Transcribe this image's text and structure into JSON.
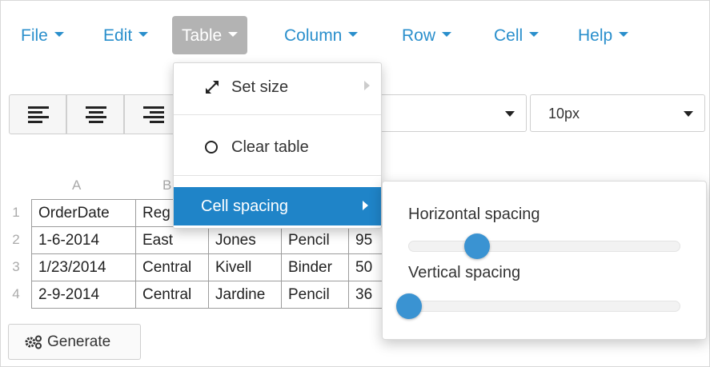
{
  "menubar": {
    "items": [
      {
        "label": "File",
        "active": false
      },
      {
        "label": "Edit",
        "active": false
      },
      {
        "label": "Table",
        "active": true
      },
      {
        "label": "Column",
        "active": false
      },
      {
        "label": "Row",
        "active": false
      },
      {
        "label": "Cell",
        "active": false
      },
      {
        "label": "Help",
        "active": false
      }
    ]
  },
  "toolbar": {
    "align_icons": [
      "align-left-icon",
      "align-center-icon",
      "align-right-icon"
    ],
    "font_select_value": "",
    "size_select_value": "10px"
  },
  "grid": {
    "column_headers": [
      "A",
      "B"
    ],
    "row_headers": [
      "1",
      "2",
      "3",
      "4"
    ],
    "rows": [
      [
        "OrderDate",
        "Reg",
        "",
        "",
        ""
      ],
      [
        "1-6-2014",
        "East",
        "Jones",
        "Pencil",
        "95"
      ],
      [
        "1/23/2014",
        "Central",
        "Kivell",
        "Binder",
        "50"
      ],
      [
        "2-9-2014",
        "Central",
        "Jardine",
        "Pencil",
        "36"
      ]
    ]
  },
  "generate_button": {
    "label": "Generate",
    "icon": "gears-icon"
  },
  "table_menu": {
    "items": [
      {
        "label": "Set size",
        "icon": "resize-icon",
        "has_submenu": true
      },
      {
        "label": "Clear table",
        "icon": "circle-icon",
        "has_submenu": false
      },
      {
        "label": "Cell spacing",
        "icon": "",
        "has_submenu": true,
        "highlighted": true
      }
    ]
  },
  "cell_spacing": {
    "horizontal_label": "Horizontal spacing",
    "horizontal_value_fraction": 0.25,
    "vertical_label": "Vertical spacing",
    "vertical_value_fraction": 0.0
  },
  "colors": {
    "accent": "#1f84c8",
    "menu_text": "#2a8fcc",
    "active_menu_bg": "#b3b3b3",
    "slider_thumb": "#3a93d2"
  }
}
